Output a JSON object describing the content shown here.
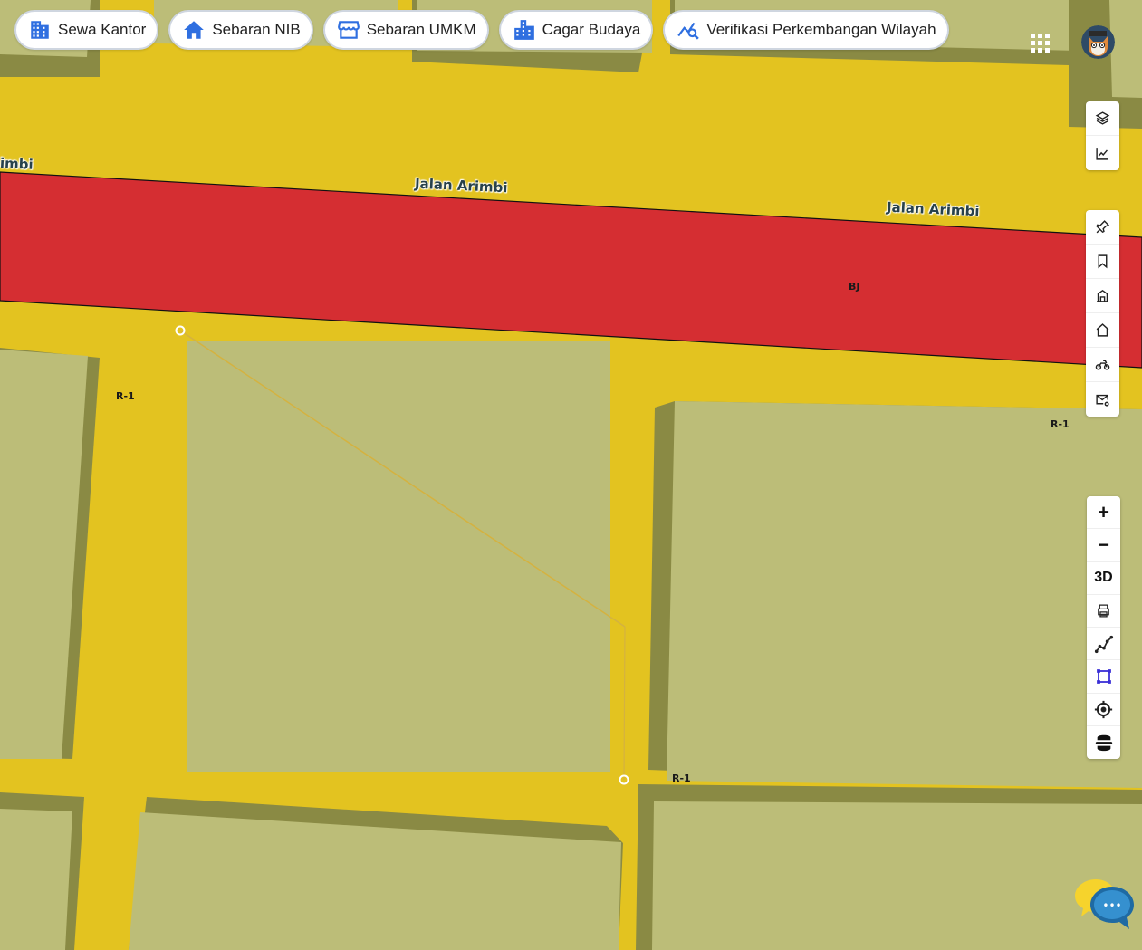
{
  "topbar": {
    "chips": [
      {
        "label": "Sewa Kantor",
        "icon": "building-icon"
      },
      {
        "label": "Sebaran NIB",
        "icon": "home-icon"
      },
      {
        "label": "Sebaran UMKM",
        "icon": "store-icon"
      },
      {
        "label": "Cagar Budaya",
        "icon": "city-icon"
      },
      {
        "label": "Verifikasi Perkembangan Wilayah",
        "icon": "chart-search-icon"
      }
    ]
  },
  "map": {
    "road_labels": [
      "Jalan Arimbi",
      "Jalan Arimbi",
      "imbi"
    ],
    "zone_labels": [
      "BJ",
      "R-1",
      "R-1",
      "R-1"
    ],
    "colors": {
      "road": "#e3c320",
      "commercial_zone": "#d52e32",
      "residential_zone": "#bcbd78",
      "building_side": "#8a8a44",
      "accent": "#2f6fe0"
    }
  },
  "controls": {
    "layer_panel": [
      "layers-icon",
      "chart-line-icon"
    ],
    "tool_panel": [
      "pin-icon",
      "bookmark-icon",
      "bank-icon",
      "house-icon",
      "motorbike-icon",
      "mail-settings-icon"
    ],
    "zoom_panel": {
      "zoom_in": "+",
      "zoom_out": "−",
      "three_d": "3D"
    }
  },
  "chat": {
    "dots": "•••"
  }
}
